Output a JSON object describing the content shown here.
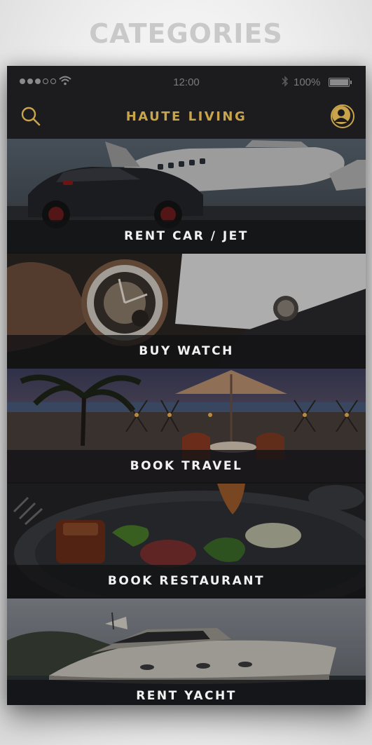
{
  "page": {
    "heading": "CATEGORIES"
  },
  "status_bar": {
    "time": "12:00",
    "battery": "100%",
    "signal_bars": 3,
    "signal_total": 5,
    "battery_level": 1.0
  },
  "nav": {
    "title": "HAUTE LIVING",
    "left_icon": "search-icon",
    "right_icon": "profile-icon"
  },
  "categories": [
    {
      "label": "RENT CAR / JET"
    },
    {
      "label": "BUY WATCH"
    },
    {
      "label": "BOOK TRAVEL"
    },
    {
      "label": "BOOK RESTAURANT"
    },
    {
      "label": "RENT YACHT"
    }
  ],
  "colors": {
    "accent": "#c9a44a",
    "background": "#1a1a1c"
  }
}
